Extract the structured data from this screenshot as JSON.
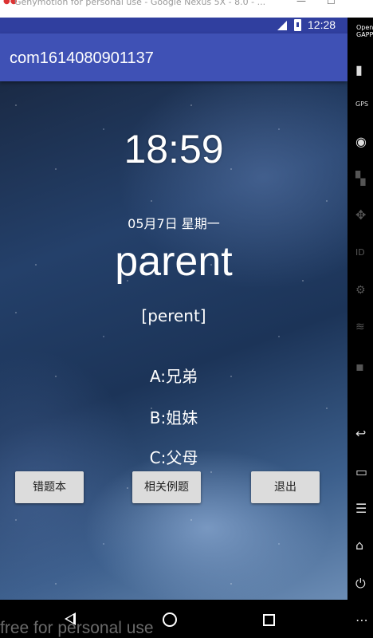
{
  "window": {
    "title": "Genymotion for personal use - Google Nexus 5X - 8.0 - ...",
    "minimize": "—",
    "maximize": "☐"
  },
  "status_bar": {
    "time": "12:28"
  },
  "app_bar": {
    "title": "com1614080901137"
  },
  "main": {
    "clock": "18:59",
    "date": "05月7日 星期一",
    "word": "parent",
    "phonetic": "[perent]",
    "options": [
      {
        "label": "A:兄弟"
      },
      {
        "label": "B:姐妹"
      },
      {
        "label": "C:父母"
      }
    ]
  },
  "buttons": {
    "wrong_book": "错题本",
    "related_examples": "相关例题",
    "exit": "退出"
  },
  "side_panel": {
    "gapps_line1": "Open",
    "gapps_line2": "GAPPS",
    "gps": "GPS",
    "id": "ID"
  },
  "navbar": {
    "watermark": "free for personal use"
  }
}
